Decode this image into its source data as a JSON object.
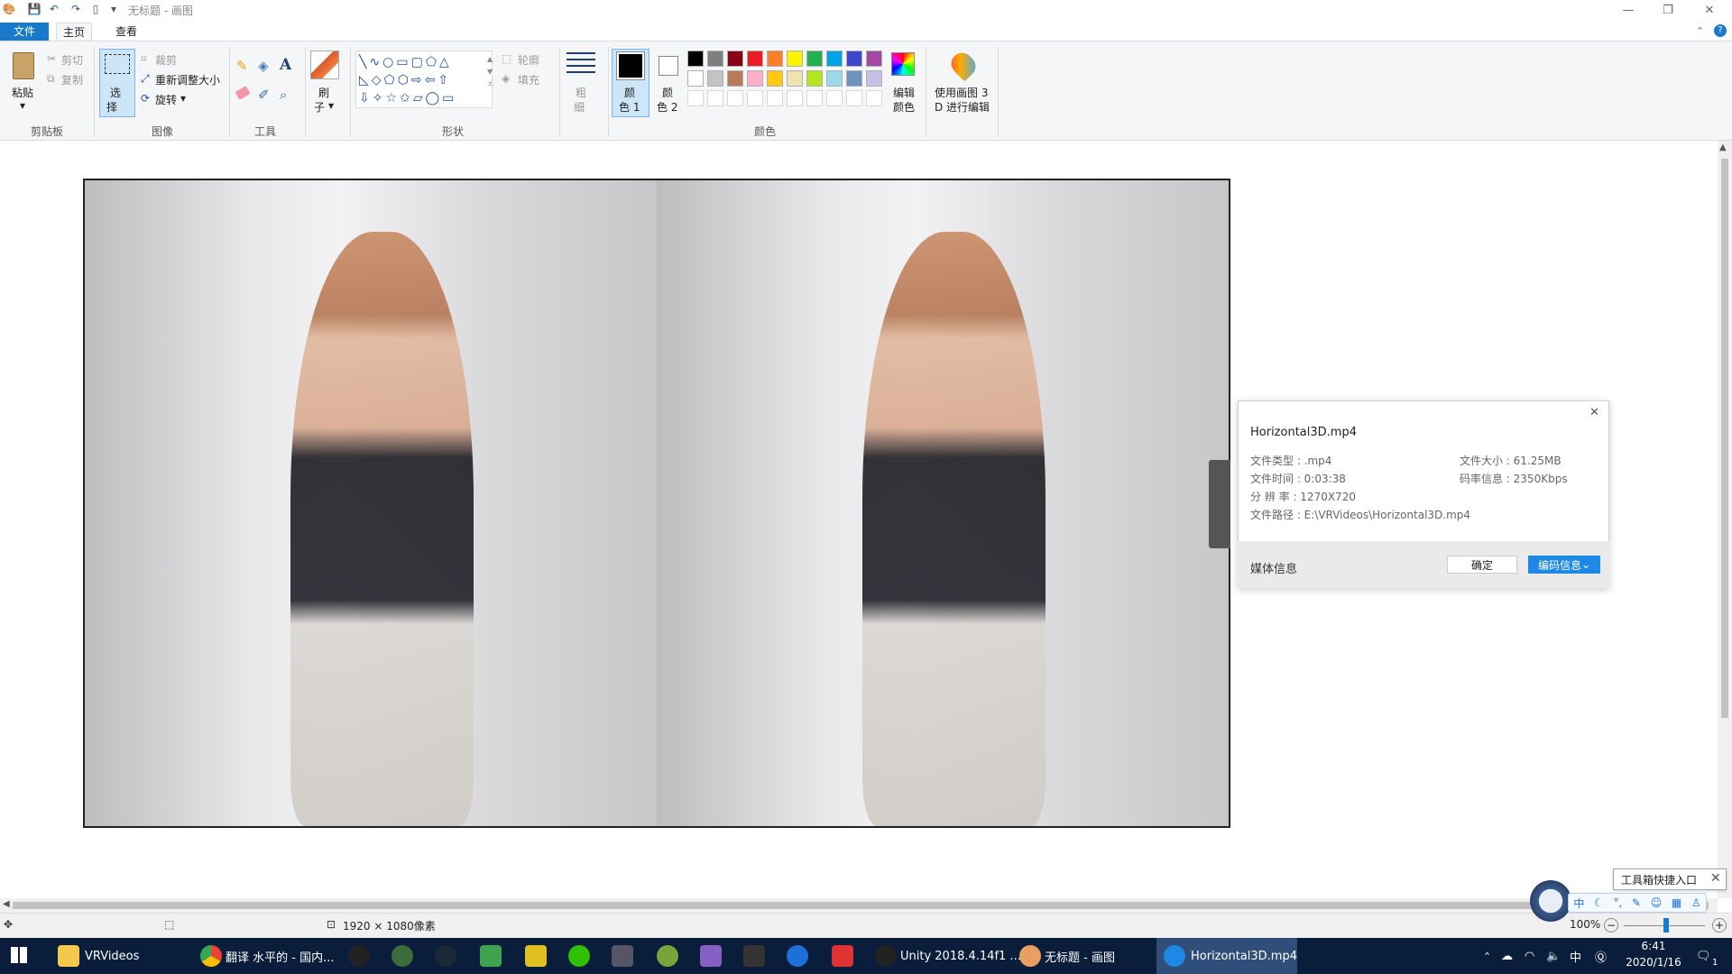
{
  "window": {
    "title": "无标题 - 画图",
    "controls": {
      "minimize": "—",
      "maximize": "❐",
      "close": "✕"
    }
  },
  "quick_access": {
    "icons": [
      "paint-app-icon",
      "save-icon",
      "undo-icon",
      "redo-icon",
      "new-file-icon",
      "customize-arrow-icon"
    ]
  },
  "menu_tabs": {
    "file": "文件",
    "home": "主页",
    "view": "查看"
  },
  "ribbon": {
    "clipboard": {
      "paste": "粘贴",
      "cut": "剪切",
      "copy": "复制",
      "group": "剪贴板"
    },
    "image": {
      "select_line1": "选",
      "select_line2": "择",
      "crop": "裁剪",
      "resize": "重新调整大小",
      "rotate": "旋转",
      "group": "图像"
    },
    "tools": {
      "group": "工具"
    },
    "brushes": {
      "line1": "刷",
      "line2": "子"
    },
    "shapes": {
      "outline": "轮廓",
      "fill": "填充",
      "group": "形状"
    },
    "size": {
      "line1": "粗",
      "line2": "细"
    },
    "colors": {
      "color1_line1": "颜",
      "color1_line2": "色 1",
      "color2_line1": "颜",
      "color2_line2": "色 2",
      "edit_line1": "编辑",
      "edit_line2": "颜色",
      "group": "颜色",
      "row1": [
        "#000000",
        "#7f7f7f",
        "#880015",
        "#ed1c24",
        "#ff7f27",
        "#fff200",
        "#22b14c",
        "#00a2e8",
        "#3f48cc",
        "#a349a4"
      ],
      "row2": [
        "#ffffff",
        "#c3c3c3",
        "#b97a57",
        "#ffaec9",
        "#ffc90e",
        "#efe4b0",
        "#b5e61d",
        "#99d9ea",
        "#7092be",
        "#c8bfe7"
      ]
    },
    "paint3d": {
      "line1": "使用画图 3",
      "line2": "D 进行编辑"
    }
  },
  "popup": {
    "filename": "Horizontal3D.mp4",
    "type": "文件类型 : .mp4",
    "duration": "文件时间 : 0:03:38",
    "resolution": "分 辨 率 : 1270X720",
    "path": "文件路径 : E:\\VRVideos\\Horizontal3D.mp4",
    "size": "文件大小 : 61.25MB",
    "bitrate": "码率信息 : 2350Kbps",
    "footer_title": "媒体信息",
    "ok": "确定",
    "encode": "编码信息"
  },
  "status": {
    "dimensions": "1920 × 1080像素",
    "zoom": "100%"
  },
  "taskbar": {
    "items": [
      {
        "label": "VRVideos"
      },
      {
        "label": "翻译 水平的 - 国内..."
      },
      {
        "label": "Unity 2018.4.14f1 ..."
      },
      {
        "label": "无标题 - 画图"
      },
      {
        "label": "Horizontal3D.mp4"
      }
    ],
    "clock_time": "6:41",
    "clock_date": "2020/1/16",
    "ime": "中",
    "notif_count": "1"
  },
  "tooltip": {
    "label": "工具箱快捷入口"
  },
  "ime_bar": {
    "lang": "中"
  }
}
